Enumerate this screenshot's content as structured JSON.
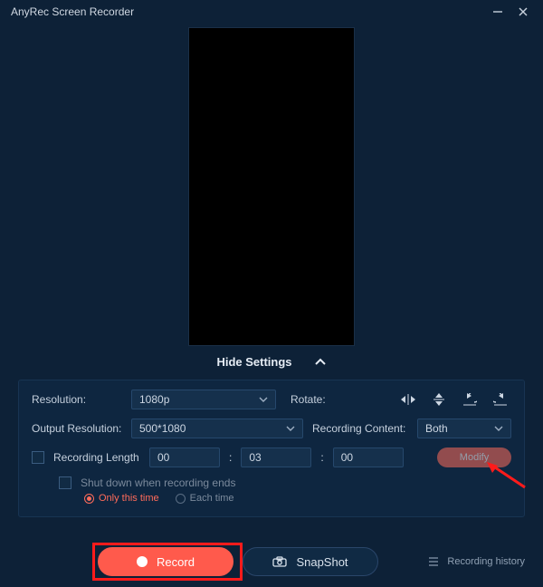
{
  "titlebar": {
    "title": "AnyRec Screen Recorder"
  },
  "hide_settings_label": "Hide Settings",
  "settings": {
    "resolution_label": "Resolution:",
    "resolution_value": "1080p",
    "rotate_label": "Rotate:",
    "output_res_label": "Output Resolution:",
    "output_res_value": "500*1080",
    "recording_content_label": "Recording Content:",
    "recording_content_value": "Both",
    "recording_length_label": "Recording Length",
    "len_h": "00",
    "len_m": "03",
    "len_s": "00",
    "modify_label": "Modify",
    "shutdown_label": "Shut down when recording ends",
    "only_this_time_label": "Only this time",
    "each_time_label": "Each time"
  },
  "footer": {
    "record_label": "Record",
    "snapshot_label": "SnapShot",
    "history_label": "Recording history"
  }
}
